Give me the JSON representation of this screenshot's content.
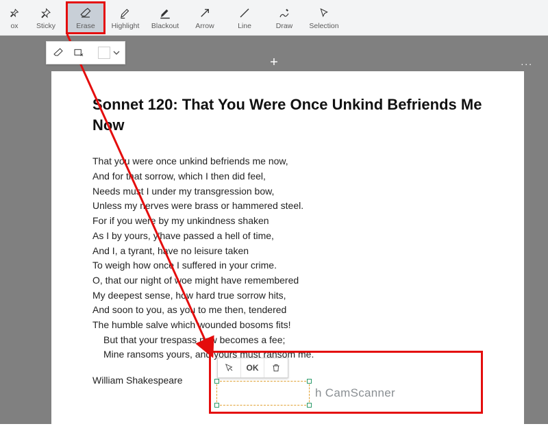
{
  "toolbar": {
    "tools": [
      {
        "id": "box",
        "label": "ox",
        "icon": "pin"
      },
      {
        "id": "sticky",
        "label": "Sticky",
        "icon": "pin"
      },
      {
        "id": "erase",
        "label": "Erase",
        "icon": "eraser",
        "active": true
      },
      {
        "id": "highlight",
        "label": "Highlight",
        "icon": "highlighter"
      },
      {
        "id": "blackout",
        "label": "Blackout",
        "icon": "blackout"
      },
      {
        "id": "arrow",
        "label": "Arrow",
        "icon": "arrow"
      },
      {
        "id": "line",
        "label": "Line",
        "icon": "line"
      },
      {
        "id": "draw",
        "label": "Draw",
        "icon": "draw"
      },
      {
        "id": "selection",
        "label": "Selection",
        "icon": "cursor"
      }
    ]
  },
  "subbar": {
    "color": "#ffffff"
  },
  "mini_toolbar": {
    "ok": "OK"
  },
  "workspace": {
    "add_tab": "+",
    "more": "..."
  },
  "document": {
    "title": "Sonnet 120: That You Were Once Unkind Befriends Me Now",
    "lines": [
      "That you were once unkind befriends me now,",
      "And for that sorrow, which I then did feel,",
      "Needs must I under my transgression bow,",
      "Unless my nerves were brass or hammered steel.",
      "For if you were by my unkindness shaken",
      "As I by yours, y'have passed a hell of time,",
      "And I, a tyrant, have no leisure taken",
      "To weigh how once I suffered in your crime.",
      "O, that our night of woe might have remembered",
      "My deepest sense, how hard true sorrow hits,",
      "And soon to you, as you to me then, tendered",
      "The humble salve which wounded bosoms fits!",
      "But that your trespass now becomes a fee;",
      "Mine ransoms yours, and yours must ransom me."
    ],
    "author": "William Shakespeare",
    "watermark": "h CamScanner"
  },
  "annotations": {
    "erase_highlight_box": {
      "desc": "red box around Erase tool"
    },
    "erase_region_box": {
      "desc": "red box around erase selection area"
    }
  }
}
